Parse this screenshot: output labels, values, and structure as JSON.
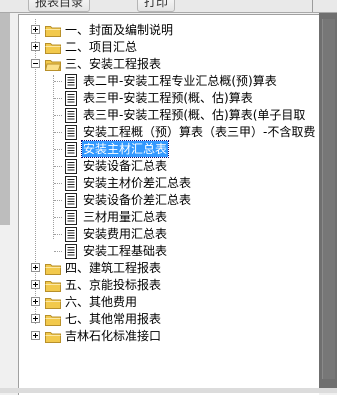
{
  "toolbar": {
    "buttons": [
      "报表目录",
      "打印"
    ]
  },
  "tree": {
    "top_nodes": [
      {
        "label": "一、封面及编制说明",
        "expanded": false
      },
      {
        "label": "二、项目汇总",
        "expanded": false
      },
      {
        "label": "三、安装工程报表",
        "expanded": true
      },
      {
        "label": "四、建筑工程报表",
        "expanded": false
      },
      {
        "label": "五、京能投标报表",
        "expanded": false
      },
      {
        "label": "六、其他费用",
        "expanded": false
      },
      {
        "label": "七、其他常用报表",
        "expanded": false
      },
      {
        "label": "吉林石化标准接口",
        "expanded": false
      }
    ],
    "children": [
      {
        "label": "表二甲-安装工程专业汇总概(预)算表"
      },
      {
        "label": "表三甲-安装工程预(概、估)算表"
      },
      {
        "label": "表三甲-安装工程预(概、估)算表(单子目取"
      },
      {
        "label": "安装工程概（预）算表（表三甲）-不含取费"
      },
      {
        "label": "安装主材汇总表",
        "selected": true
      },
      {
        "label": "安装设备汇总表"
      },
      {
        "label": "安装主材价差汇总表"
      },
      {
        "label": "安装设备价差汇总表"
      },
      {
        "label": "三材用量汇总表"
      },
      {
        "label": "安装费用汇总表"
      },
      {
        "label": "安装工程基础表"
      }
    ]
  },
  "colors": {
    "folder": "#f2c94c",
    "selection": "#3399ff"
  }
}
